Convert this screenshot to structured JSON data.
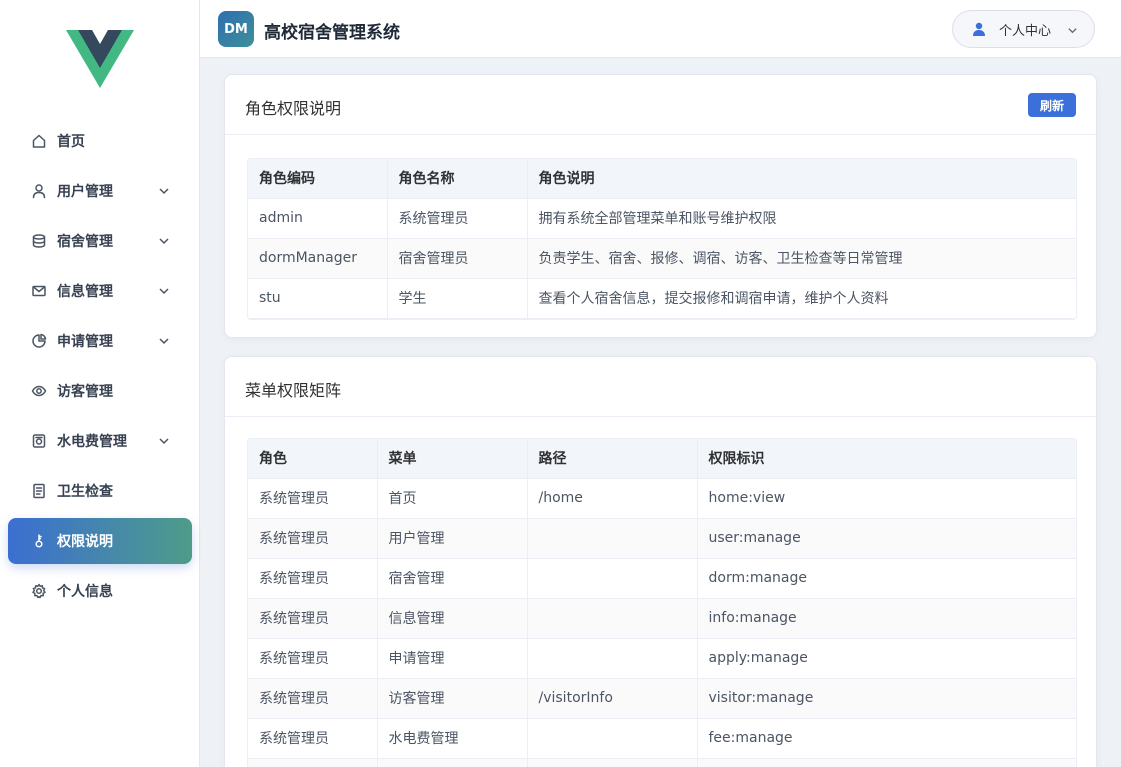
{
  "app": {
    "brand_badge": "DM",
    "title": "高校宿舍管理系统"
  },
  "header": {
    "user_center_label": "个人中心"
  },
  "sidebar": {
    "items": [
      {
        "label": "首页",
        "icon": "home-icon",
        "has_submenu": false,
        "active": false
      },
      {
        "label": "用户管理",
        "icon": "user-icon",
        "has_submenu": true,
        "active": false
      },
      {
        "label": "宿舍管理",
        "icon": "database-icon",
        "has_submenu": true,
        "active": false
      },
      {
        "label": "信息管理",
        "icon": "message-icon",
        "has_submenu": true,
        "active": false
      },
      {
        "label": "申请管理",
        "icon": "pie-chart-icon",
        "has_submenu": true,
        "active": false
      },
      {
        "label": "访客管理",
        "icon": "eye-icon",
        "has_submenu": false,
        "active": false
      },
      {
        "label": "水电费管理",
        "icon": "meter-icon",
        "has_submenu": true,
        "active": false
      },
      {
        "label": "卫生检查",
        "icon": "document-icon",
        "has_submenu": false,
        "active": false
      },
      {
        "label": "权限说明",
        "icon": "key-icon",
        "has_submenu": false,
        "active": true
      },
      {
        "label": "个人信息",
        "icon": "gear-icon",
        "has_submenu": false,
        "active": false
      }
    ]
  },
  "role_card": {
    "title": "角色权限说明",
    "refresh_label": "刷新",
    "columns": [
      "角色编码",
      "角色名称",
      "角色说明"
    ],
    "rows": [
      [
        "admin",
        "系统管理员",
        "拥有系统全部管理菜单和账号维护权限"
      ],
      [
        "dormManager",
        "宿舍管理员",
        "负责学生、宿舍、报修、调宿、访客、卫生检查等日常管理"
      ],
      [
        "stu",
        "学生",
        "查看个人宿舍信息，提交报修和调宿申请，维护个人资料"
      ]
    ]
  },
  "menu_card": {
    "title": "菜单权限矩阵",
    "columns": [
      "角色",
      "菜单",
      "路径",
      "权限标识"
    ],
    "rows": [
      [
        "系统管理员",
        "首页",
        "/home",
        "home:view"
      ],
      [
        "系统管理员",
        "用户管理",
        "",
        "user:manage"
      ],
      [
        "系统管理员",
        "宿舍管理",
        "",
        "dorm:manage"
      ],
      [
        "系统管理员",
        "信息管理",
        "",
        "info:manage"
      ],
      [
        "系统管理员",
        "申请管理",
        "",
        "apply:manage"
      ],
      [
        "系统管理员",
        "访客管理",
        "/visitorInfo",
        "visitor:manage"
      ],
      [
        "系统管理员",
        "水电费管理",
        "",
        "fee:manage"
      ],
      [
        "",
        "",
        "",
        ""
      ]
    ]
  },
  "colors": {
    "accent": "#3b6fd9",
    "active_gradient_end": "#4e9c8a",
    "logo_green": "#42b883",
    "logo_dark": "#35495e"
  }
}
